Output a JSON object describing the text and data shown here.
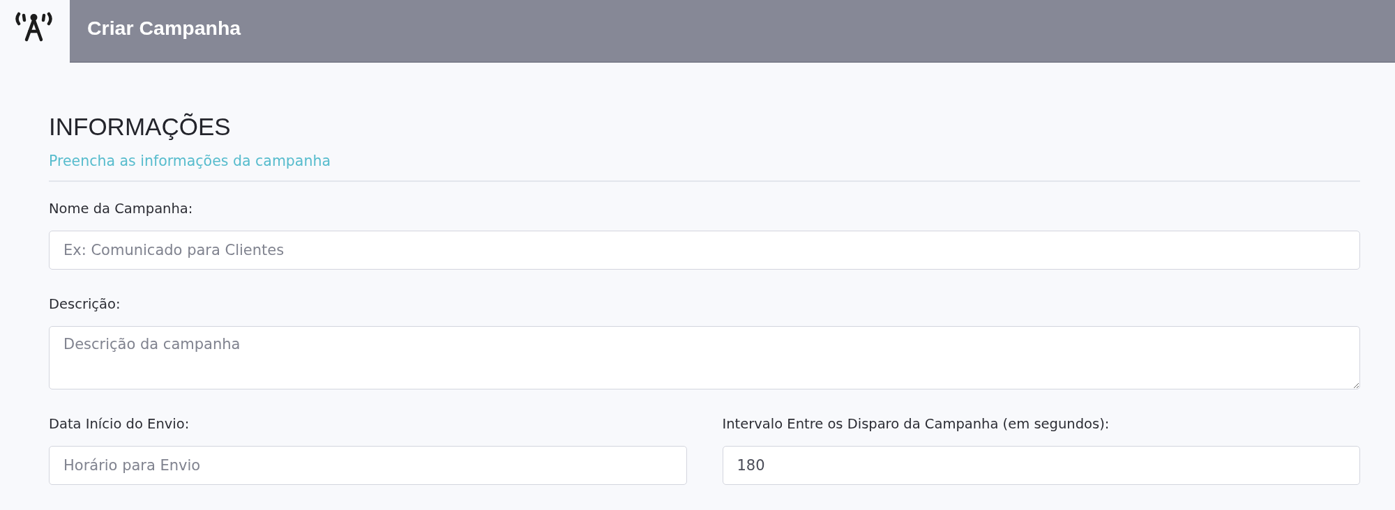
{
  "header": {
    "title": "Criar Campanha"
  },
  "section": {
    "title": "INFORMAÇÕES",
    "subtitle": "Preencha as informações da campanha"
  },
  "fields": [
    {
      "kind": "input",
      "label": "Nome da Campanha:",
      "placeholder": "Ex: Comunicado para Clientes"
    },
    {
      "kind": "textarea",
      "label": "Descrição:",
      "placeholder": "Descrição da campanha"
    }
  ],
  "columns": [
    {
      "kind": "input",
      "label": "Data Início do Envio:",
      "placeholder": "Horário para Envio"
    },
    {
      "kind": "input",
      "label": "Intervalo Entre os Disparo da Campanha (em segundos):",
      "value": "180"
    }
  ]
}
